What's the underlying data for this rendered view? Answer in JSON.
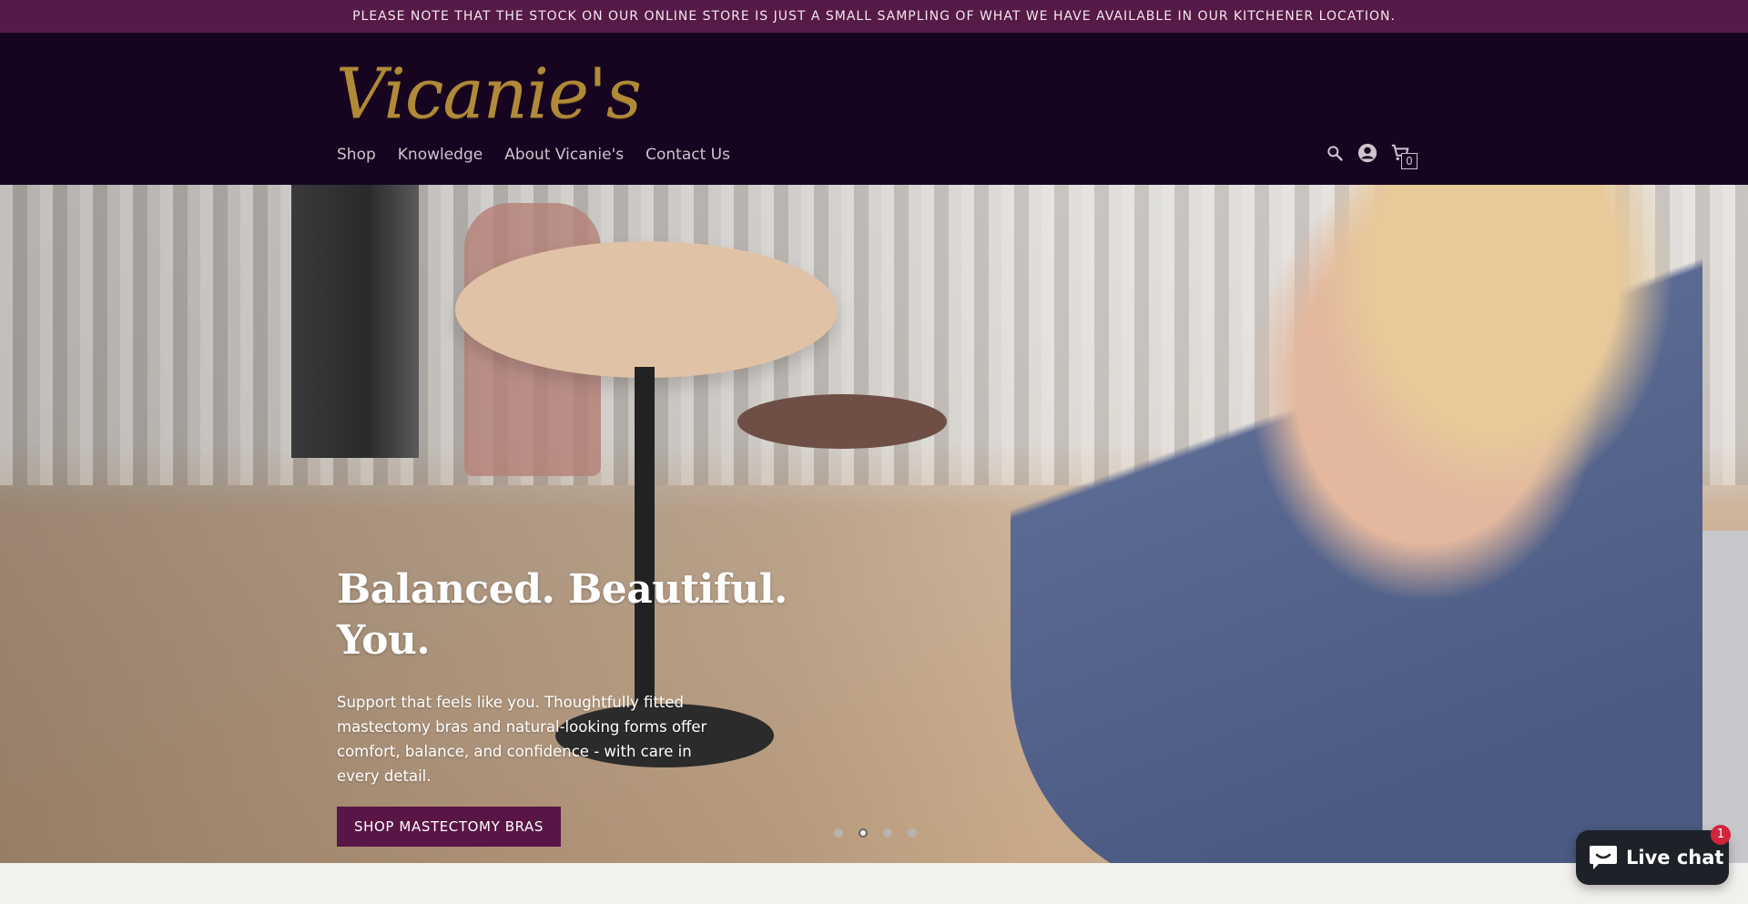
{
  "announcement": {
    "text": "PLEASE NOTE THAT THE STOCK ON OUR ONLINE STORE IS JUST A SMALL SAMPLING OF WHAT WE HAVE AVAILABLE IN OUR KITCHENER LOCATION."
  },
  "header": {
    "logo_text": "Vicanie's",
    "nav": [
      {
        "label": "Shop"
      },
      {
        "label": "Knowledge"
      },
      {
        "label": "About Vicanie's"
      },
      {
        "label": "Contact Us"
      }
    ],
    "icons": [
      "search-icon",
      "account-icon",
      "cart-icon"
    ],
    "cart_count": "0"
  },
  "hero": {
    "title": "Balanced. Beautiful. You.",
    "text": "Support that feels like you. Thoughtfully fitted mastectomy bras and natural-looking forms offer comfort, balance, and confidence - with care in every detail.",
    "button_label": "SHOP MASTECTOMY BRAS",
    "slides": 4,
    "active_slide": 2
  },
  "chat": {
    "label": "Live chat",
    "badge": "1"
  },
  "colors": {
    "announcement_bg": "#561a47",
    "header_bg": "#160420",
    "logo": "#b08a38",
    "button_bg": "#5a1547",
    "chat_bg": "#1e2228",
    "chat_badge": "#d2233b"
  }
}
